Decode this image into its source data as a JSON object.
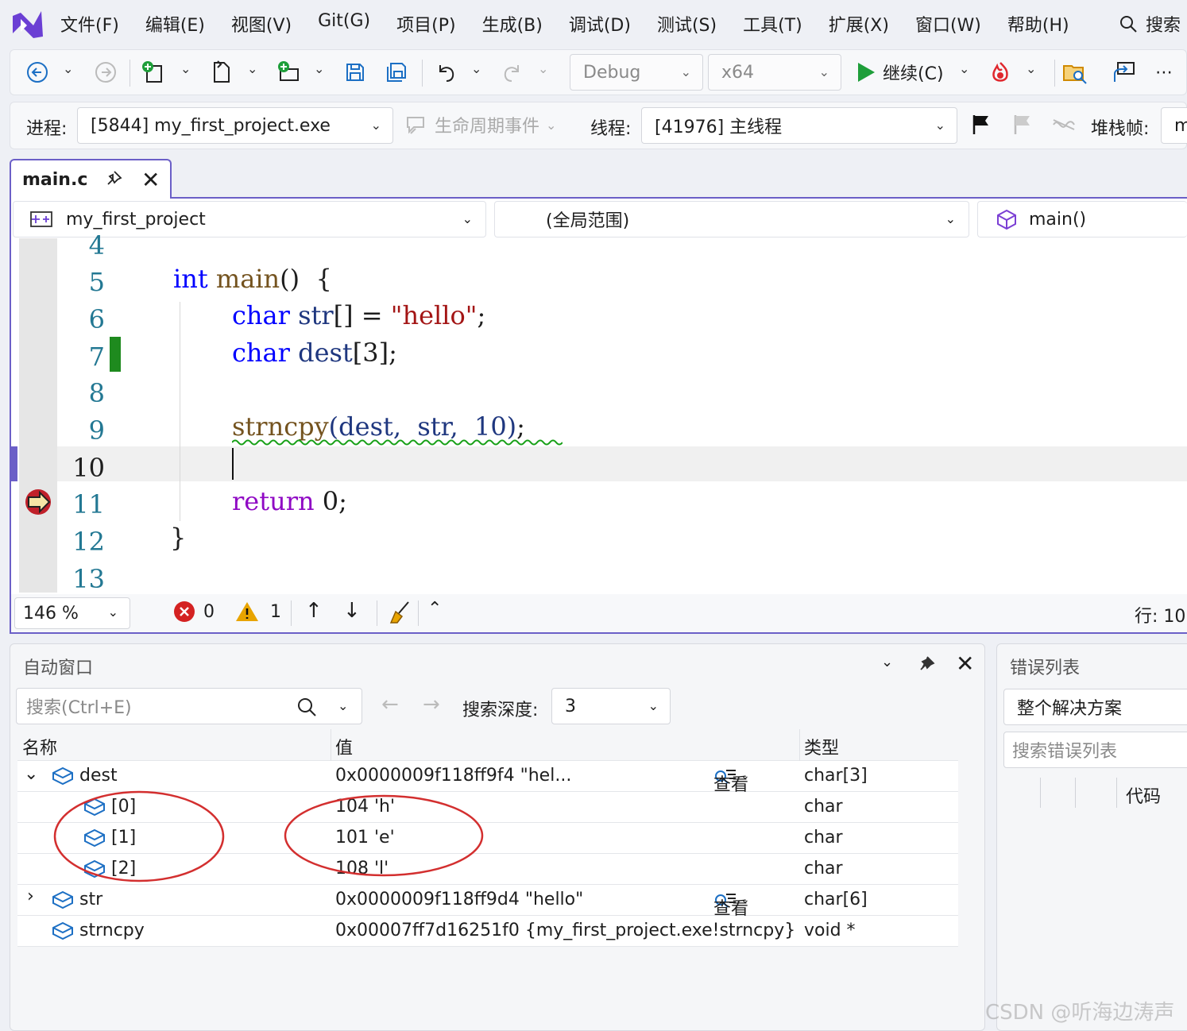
{
  "menubar": {
    "items": [
      "文件(F)",
      "编辑(E)",
      "视图(V)",
      "Git(G)",
      "项目(P)",
      "生成(B)",
      "调试(D)",
      "测试(S)",
      "工具(T)",
      "扩展(X)",
      "窗口(W)",
      "帮助(H)"
    ],
    "search_label": "搜索"
  },
  "toolbar": {
    "config": "Debug",
    "platform": "x64",
    "continue_label": "继续(C)"
  },
  "debugbar": {
    "process_label": "进程:",
    "process_value": "[5844] my_first_project.exe",
    "lifecycle_label": "生命周期事件",
    "thread_label": "线程:",
    "thread_value": "[41976] 主线程",
    "stackframe_label": "堆栈帧:",
    "stackframe_value": "m"
  },
  "editor": {
    "tab_label": "main.c",
    "nav_project": "my_first_project",
    "nav_scope": "(全局范围)",
    "nav_function": "main()",
    "lines": [
      "4",
      "5",
      "6",
      "7",
      "8",
      "9",
      "10",
      "11",
      "12",
      "13"
    ],
    "code": {
      "l5_kw": "int",
      "l5_fn": "main",
      "l5_rest": "()  {",
      "l6_kw": "char",
      "l6_id": "str",
      "l6_mid": "[] = ",
      "l6_str": "\"hello\"",
      "l6_end": ";",
      "l7_kw": "char",
      "l7_id": "dest",
      "l7_rest": "[3];",
      "l9_fn": "strncpy",
      "l9_rest": "(dest,  str,  10)",
      "l9_end": ";",
      "l11_kw": "return",
      "l11_rest": " 0;",
      "l12": "}"
    }
  },
  "statusbar": {
    "zoom": "146 %",
    "errors": "0",
    "warnings": "1",
    "position": "行: 10"
  },
  "autos": {
    "title": "自动窗口",
    "search_placeholder": "搜索(Ctrl+E)",
    "depth_label": "搜索深度:",
    "depth_value": "3",
    "columns": {
      "name": "名称",
      "value": "值",
      "type": "类型"
    },
    "view_label": "查看",
    "rows": [
      {
        "name": "dest",
        "value": "0x0000009f118ff9f4 \"hel...",
        "type": "char[3]"
      },
      {
        "name": "[0]",
        "value": "104 'h'",
        "type": "char"
      },
      {
        "name": "[1]",
        "value": "101 'e'",
        "type": "char"
      },
      {
        "name": "[2]",
        "value": "108 'l'",
        "type": "char"
      },
      {
        "name": "str",
        "value": "0x0000009f118ff9d4 \"hello\"",
        "type": "char[6]"
      },
      {
        "name": "strncpy",
        "value": "0x00007ff7d16251f0 {my_first_project.exe!strncpy}",
        "type": "void *"
      }
    ]
  },
  "errors": {
    "title": "错误列表",
    "scope": "整个解决方案",
    "search_placeholder": "搜索错误列表",
    "col_code": "代码"
  },
  "watermark": "CSDN @听海边涛声",
  "colors": {
    "accent": "#6b5fc7",
    "keyword": "#0000ff",
    "string": "#a31515",
    "control": "#8f08c4",
    "function": "#74531f",
    "annotation_circle": "#d32f2f"
  }
}
